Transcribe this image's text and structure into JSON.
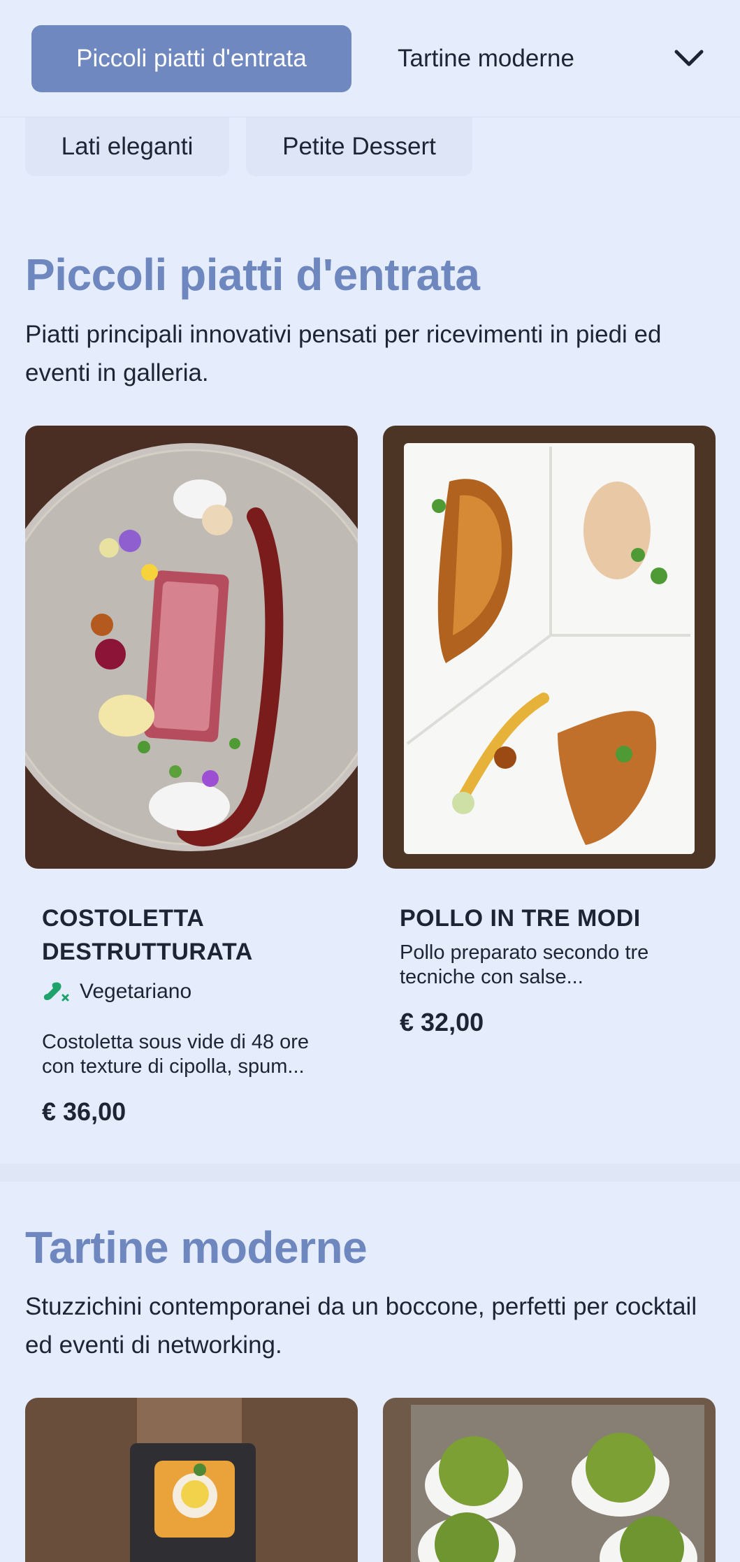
{
  "nav": {
    "tabs": [
      "Piccoli piatti d'entrata",
      "Tartine moderne"
    ],
    "more": [
      "Lati eleganti",
      "Petite Dessert"
    ],
    "accent": "#7088c0"
  },
  "sections": [
    {
      "title": "Piccoli piatti d'entrata",
      "description": "Piatti principali innovativi pensati per ricevimenti in piedi ed eventi in galleria.",
      "items": [
        {
          "title": "COSTOLETTA DESTRUTTURATA",
          "tag": "Vegetariano",
          "tag_icon": "vegetarian-leg-icon",
          "description_l1": "Costoletta sous vide di 48 ore",
          "description_l2": "con texture di cipolla, spum...",
          "price": "€ 36,00"
        },
        {
          "title": "POLLO IN TRE MODI",
          "description_l1": "Pollo preparato secondo tre",
          "description_l2": "tecniche con salse...",
          "price": "€ 32,00"
        }
      ]
    },
    {
      "title": "Tartine moderne",
      "description": "Stuzzichini contemporanei da un boccone, perfetti per cocktail ed eventi di networking."
    }
  ]
}
